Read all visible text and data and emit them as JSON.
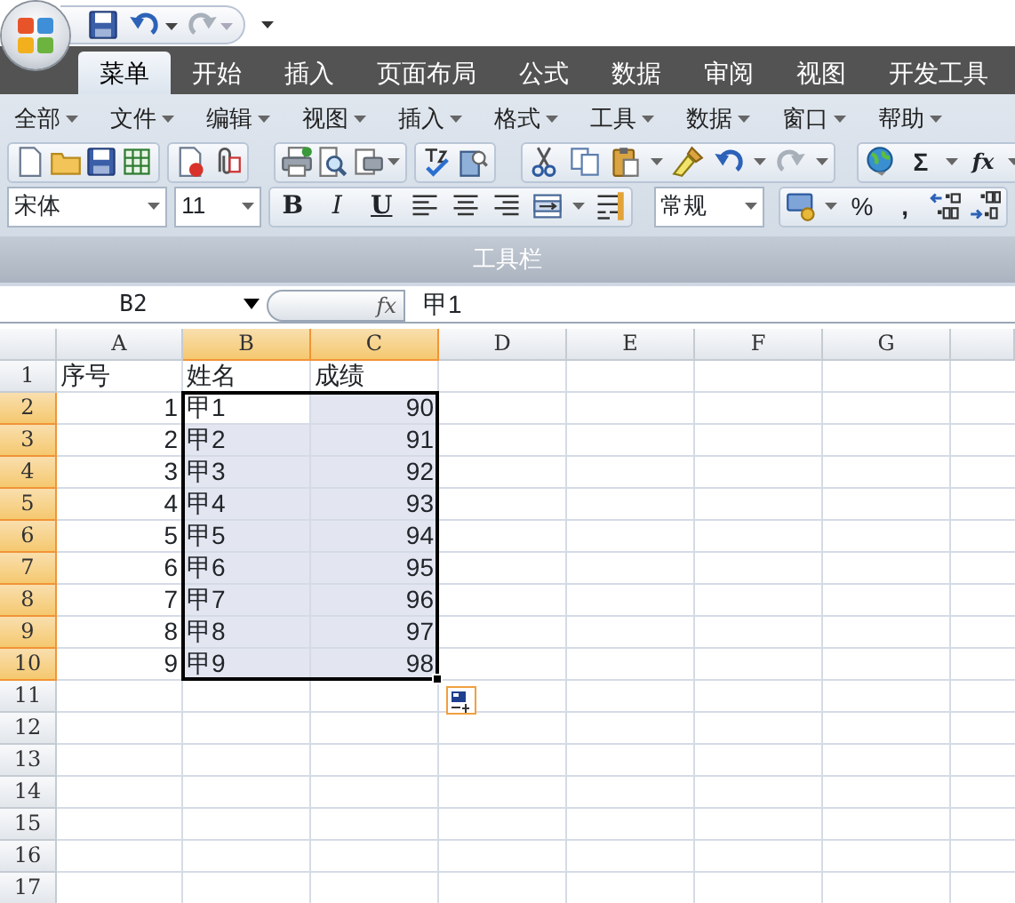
{
  "quick_access": {
    "redo_disabled": true,
    "undo_disabled": false
  },
  "tabs": [
    {
      "label": "菜单",
      "selected": true
    },
    {
      "label": "开始",
      "selected": false
    },
    {
      "label": "插入",
      "selected": false
    },
    {
      "label": "页面布局",
      "selected": false
    },
    {
      "label": "公式",
      "selected": false
    },
    {
      "label": "数据",
      "selected": false
    },
    {
      "label": "审阅",
      "selected": false
    },
    {
      "label": "视图",
      "selected": false
    },
    {
      "label": "开发工具",
      "selected": false
    }
  ],
  "menu": [
    "全部",
    "文件",
    "编辑",
    "视图",
    "插入",
    "格式",
    "工具",
    "数据",
    "窗口",
    "帮助"
  ],
  "toolbar": {
    "font": "宋体",
    "size": "11",
    "number_format": "常规",
    "glyphs": [
      "Σ",
      "fx",
      "B",
      "I",
      "U",
      "%",
      ","
    ],
    "group_label": "工具栏"
  },
  "formula_bar": {
    "name_box": "B2",
    "fx": "fx",
    "formula": "甲1"
  },
  "sheet": {
    "columns": [
      {
        "label": "A",
        "selected": false
      },
      {
        "label": "B",
        "selected": true
      },
      {
        "label": "C",
        "selected": true
      },
      {
        "label": "D",
        "selected": false
      },
      {
        "label": "E",
        "selected": false
      },
      {
        "label": "F",
        "selected": false
      },
      {
        "label": "G",
        "selected": false
      }
    ],
    "rows": [
      {
        "label": "1",
        "selected": false,
        "cells": [
          {
            "text": "序号",
            "kind": "text"
          },
          {
            "text": "姓名",
            "kind": "text"
          },
          {
            "text": "成绩",
            "kind": "text"
          }
        ]
      },
      {
        "label": "2",
        "selected": true,
        "cells": [
          {
            "text": "1",
            "kind": "number"
          },
          {
            "text": "甲1",
            "kind": "text"
          },
          {
            "text": "90",
            "kind": "number"
          }
        ]
      },
      {
        "label": "3",
        "selected": true,
        "cells": [
          {
            "text": "2",
            "kind": "number"
          },
          {
            "text": "甲2",
            "kind": "text"
          },
          {
            "text": "91",
            "kind": "number"
          }
        ]
      },
      {
        "label": "4",
        "selected": true,
        "cells": [
          {
            "text": "3",
            "kind": "number"
          },
          {
            "text": "甲3",
            "kind": "text"
          },
          {
            "text": "92",
            "kind": "number"
          }
        ]
      },
      {
        "label": "5",
        "selected": true,
        "cells": [
          {
            "text": "4",
            "kind": "number"
          },
          {
            "text": "甲4",
            "kind": "text"
          },
          {
            "text": "93",
            "kind": "number"
          }
        ]
      },
      {
        "label": "6",
        "selected": true,
        "cells": [
          {
            "text": "5",
            "kind": "number"
          },
          {
            "text": "甲5",
            "kind": "text"
          },
          {
            "text": "94",
            "kind": "number"
          }
        ]
      },
      {
        "label": "7",
        "selected": true,
        "cells": [
          {
            "text": "6",
            "kind": "number"
          },
          {
            "text": "甲6",
            "kind": "text"
          },
          {
            "text": "95",
            "kind": "number"
          }
        ]
      },
      {
        "label": "8",
        "selected": true,
        "cells": [
          {
            "text": "7",
            "kind": "number"
          },
          {
            "text": "甲7",
            "kind": "text"
          },
          {
            "text": "96",
            "kind": "number"
          }
        ]
      },
      {
        "label": "9",
        "selected": true,
        "cells": [
          {
            "text": "8",
            "kind": "number"
          },
          {
            "text": "甲8",
            "kind": "text"
          },
          {
            "text": "97",
            "kind": "number"
          }
        ]
      },
      {
        "label": "10",
        "selected": true,
        "cells": [
          {
            "text": "9",
            "kind": "number"
          },
          {
            "text": "甲9",
            "kind": "text"
          },
          {
            "text": "98",
            "kind": "number"
          }
        ]
      },
      {
        "label": "11",
        "selected": false,
        "cells": []
      },
      {
        "label": "12",
        "selected": false,
        "cells": []
      },
      {
        "label": "13",
        "selected": false,
        "cells": []
      },
      {
        "label": "14",
        "selected": false,
        "cells": []
      },
      {
        "label": "15",
        "selected": false,
        "cells": []
      },
      {
        "label": "16",
        "selected": false,
        "cells": []
      },
      {
        "label": "17",
        "selected": false,
        "cells": []
      }
    ]
  }
}
